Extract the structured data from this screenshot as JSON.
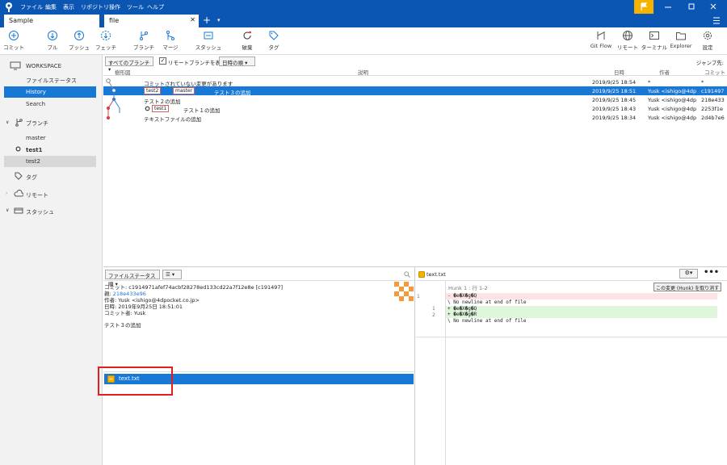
{
  "menu": [
    "ファイル",
    "編集",
    "表示",
    "リポジトリ",
    "操作",
    "ツール",
    "ヘルプ"
  ],
  "tabs": {
    "search_value": "Sample",
    "active_tab": "file",
    "add": "+",
    "more": "▾"
  },
  "toolbar": {
    "left": [
      "コミット",
      "プル",
      "プッシュ",
      "フェッチ",
      "ブランチ",
      "マージ",
      "スタッシュ",
      "破棄",
      "タグ"
    ],
    "right": [
      "Git Flow",
      "リモート",
      "ターミナル",
      "Explorer",
      "設定"
    ]
  },
  "sidebar": {
    "workspace": "WORKSPACE",
    "file_status": "ファイルステータス",
    "history": "History",
    "search": "Search",
    "branches": "ブランチ",
    "master": "master",
    "test1": "test1",
    "test2": "test2",
    "tags": "タグ",
    "remote": "リモート",
    "stash": "スタッシュ"
  },
  "filters": {
    "branches": "すべてのブランチ ▾",
    "show_remote": "リモートブランチを表示",
    "order": "日時の順 ▾",
    "jump": "ジャンプ先:"
  },
  "columns": {
    "graph": "樹形図",
    "desc": "説明",
    "date": "日時",
    "author": "作者",
    "commit": "コミット"
  },
  "commits": [
    {
      "desc": "コミットされていない変更があります",
      "date": "2019/9/25 18:54",
      "author": "*",
      "hash": "*",
      "refs": []
    },
    {
      "desc": "テスト３の追加",
      "date": "2019/9/25 18:51",
      "author": "Yusk <ishigo@4dp",
      "hash": "c191497",
      "refs": [
        "test2",
        "master"
      ]
    },
    {
      "desc": "テスト２の追加",
      "date": "2019/9/25 18:45",
      "author": "Yusk <ishigo@4dp",
      "hash": "218e433",
      "refs": []
    },
    {
      "desc": "テスト１の追加",
      "date": "2019/9/25 18:43",
      "author": "Yusk <ishigo@4dp",
      "hash": "2253f1e",
      "refs": [
        "test1"
      ]
    },
    {
      "desc": "テキストファイルの追加",
      "date": "2019/9/25 18:34",
      "author": "Yusk <ishigo@4dp",
      "hash": "2d4b7e6",
      "refs": []
    }
  ],
  "details": {
    "sort": "ファイルステータス順 ▾",
    "view": "☰ ▾",
    "commit_line": "コミット: c1914971afef74acbf28278ed133cd22a7f12e8e [c191497]",
    "parent_label": "親:",
    "parent": "218e433e96",
    "author_line": "作者: Yusk <ishigo@4dpocket.co.jp>",
    "date_line": "日時: 2019年9月25日 18:51:01",
    "committer_line": "コミット者: Yusk",
    "message": "テスト３の追加",
    "file": "text.txt"
  },
  "diff": {
    "file": "text.txt",
    "hunk": "Hunk 1 : 行 1-2",
    "discard": "この変更 (Hunk) を取り消す",
    "lines": [
      {
        "old": "1",
        "new": "",
        "text": "- �e�X�g�Q",
        "type": "del"
      },
      {
        "old": "",
        "new": "",
        "text": "\\  No newline at end of file",
        "type": "ctx"
      },
      {
        "old": "",
        "new": "1",
        "text": "+ �e�X�g�Q",
        "type": "add"
      },
      {
        "old": "",
        "new": "2",
        "text": "+ �e�X�g�R",
        "type": "add"
      },
      {
        "old": "",
        "new": "",
        "text": "\\  No newline at end of file",
        "type": "ctx"
      }
    ]
  },
  "colors": {
    "accent": "#1878d6",
    "titlebar": "#0b55b3",
    "branch_red": "#d9424a",
    "highlight": "#e0201e"
  }
}
